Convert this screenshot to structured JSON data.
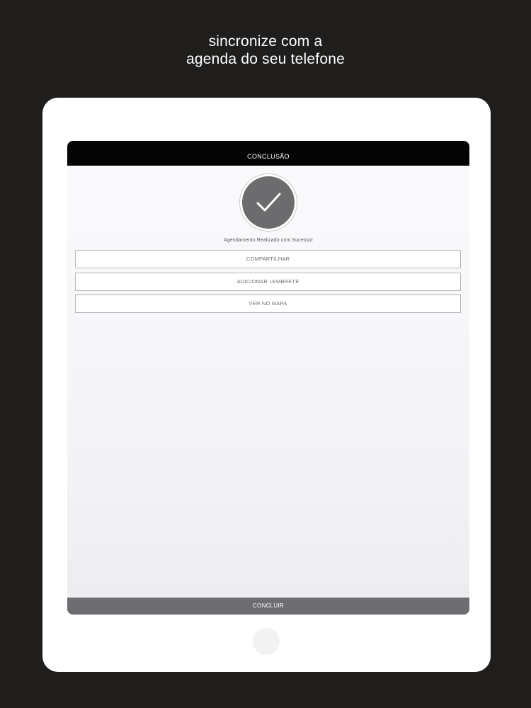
{
  "headline": {
    "line1": "sincronize com a",
    "line2": "agenda do seu telefone"
  },
  "screen": {
    "title": "CONCLUSÃO",
    "status_icon": "check-icon",
    "success_message": "Agendamento Realizado com Sucesso!",
    "actions": [
      {
        "label": "COMPARTILHAR"
      },
      {
        "label": "ADICIONAR LEMBRETE"
      },
      {
        "label": "VER NO MAPA"
      }
    ],
    "footer_button": "CONCLUIR"
  },
  "colors": {
    "page_background": "#1f1e1c",
    "device_frame": "#ffffff",
    "top_bar": "#050505",
    "check_disc": "#6c6b6e",
    "footer_bar": "#6e6d71"
  }
}
